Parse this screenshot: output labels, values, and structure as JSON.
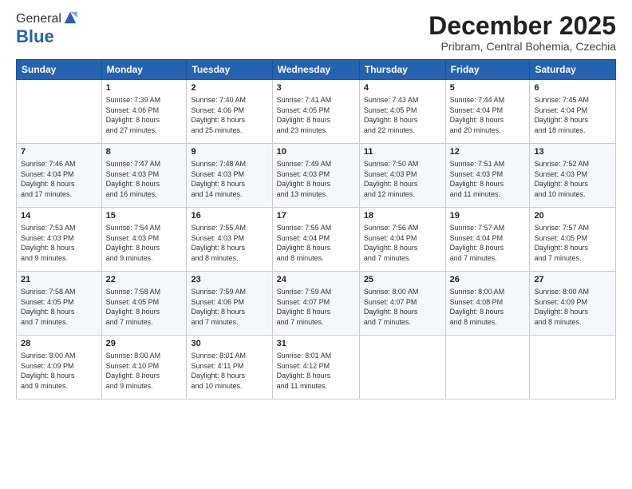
{
  "logo": {
    "general": "General",
    "blue": "Blue"
  },
  "header": {
    "month": "December 2025",
    "location": "Pribram, Central Bohemia, Czechia"
  },
  "weekdays": [
    "Sunday",
    "Monday",
    "Tuesday",
    "Wednesday",
    "Thursday",
    "Friday",
    "Saturday"
  ],
  "weeks": [
    [
      {
        "day": "",
        "info": ""
      },
      {
        "day": "1",
        "info": "Sunrise: 7:39 AM\nSunset: 4:06 PM\nDaylight: 8 hours\nand 27 minutes."
      },
      {
        "day": "2",
        "info": "Sunrise: 7:40 AM\nSunset: 4:06 PM\nDaylight: 8 hours\nand 25 minutes."
      },
      {
        "day": "3",
        "info": "Sunrise: 7:41 AM\nSunset: 4:05 PM\nDaylight: 8 hours\nand 23 minutes."
      },
      {
        "day": "4",
        "info": "Sunrise: 7:43 AM\nSunset: 4:05 PM\nDaylight: 8 hours\nand 22 minutes."
      },
      {
        "day": "5",
        "info": "Sunrise: 7:44 AM\nSunset: 4:04 PM\nDaylight: 8 hours\nand 20 minutes."
      },
      {
        "day": "6",
        "info": "Sunrise: 7:45 AM\nSunset: 4:04 PM\nDaylight: 8 hours\nand 18 minutes."
      }
    ],
    [
      {
        "day": "7",
        "info": "Sunrise: 7:46 AM\nSunset: 4:04 PM\nDaylight: 8 hours\nand 17 minutes."
      },
      {
        "day": "8",
        "info": "Sunrise: 7:47 AM\nSunset: 4:03 PM\nDaylight: 8 hours\nand 16 minutes."
      },
      {
        "day": "9",
        "info": "Sunrise: 7:48 AM\nSunset: 4:03 PM\nDaylight: 8 hours\nand 14 minutes."
      },
      {
        "day": "10",
        "info": "Sunrise: 7:49 AM\nSunset: 4:03 PM\nDaylight: 8 hours\nand 13 minutes."
      },
      {
        "day": "11",
        "info": "Sunrise: 7:50 AM\nSunset: 4:03 PM\nDaylight: 8 hours\nand 12 minutes."
      },
      {
        "day": "12",
        "info": "Sunrise: 7:51 AM\nSunset: 4:03 PM\nDaylight: 8 hours\nand 11 minutes."
      },
      {
        "day": "13",
        "info": "Sunrise: 7:52 AM\nSunset: 4:03 PM\nDaylight: 8 hours\nand 10 minutes."
      }
    ],
    [
      {
        "day": "14",
        "info": "Sunrise: 7:53 AM\nSunset: 4:03 PM\nDaylight: 8 hours\nand 9 minutes."
      },
      {
        "day": "15",
        "info": "Sunrise: 7:54 AM\nSunset: 4:03 PM\nDaylight: 8 hours\nand 9 minutes."
      },
      {
        "day": "16",
        "info": "Sunrise: 7:55 AM\nSunset: 4:03 PM\nDaylight: 8 hours\nand 8 minutes."
      },
      {
        "day": "17",
        "info": "Sunrise: 7:55 AM\nSunset: 4:04 PM\nDaylight: 8 hours\nand 8 minutes."
      },
      {
        "day": "18",
        "info": "Sunrise: 7:56 AM\nSunset: 4:04 PM\nDaylight: 8 hours\nand 7 minutes."
      },
      {
        "day": "19",
        "info": "Sunrise: 7:57 AM\nSunset: 4:04 PM\nDaylight: 8 hours\nand 7 minutes."
      },
      {
        "day": "20",
        "info": "Sunrise: 7:57 AM\nSunset: 4:05 PM\nDaylight: 8 hours\nand 7 minutes."
      }
    ],
    [
      {
        "day": "21",
        "info": "Sunrise: 7:58 AM\nSunset: 4:05 PM\nDaylight: 8 hours\nand 7 minutes."
      },
      {
        "day": "22",
        "info": "Sunrise: 7:58 AM\nSunset: 4:05 PM\nDaylight: 8 hours\nand 7 minutes."
      },
      {
        "day": "23",
        "info": "Sunrise: 7:59 AM\nSunset: 4:06 PM\nDaylight: 8 hours\nand 7 minutes."
      },
      {
        "day": "24",
        "info": "Sunrise: 7:59 AM\nSunset: 4:07 PM\nDaylight: 8 hours\nand 7 minutes."
      },
      {
        "day": "25",
        "info": "Sunrise: 8:00 AM\nSunset: 4:07 PM\nDaylight: 8 hours\nand 7 minutes."
      },
      {
        "day": "26",
        "info": "Sunrise: 8:00 AM\nSunset: 4:08 PM\nDaylight: 8 hours\nand 8 minutes."
      },
      {
        "day": "27",
        "info": "Sunrise: 8:00 AM\nSunset: 4:09 PM\nDaylight: 8 hours\nand 8 minutes."
      }
    ],
    [
      {
        "day": "28",
        "info": "Sunrise: 8:00 AM\nSunset: 4:09 PM\nDaylight: 8 hours\nand 9 minutes."
      },
      {
        "day": "29",
        "info": "Sunrise: 8:00 AM\nSunset: 4:10 PM\nDaylight: 8 hours\nand 9 minutes."
      },
      {
        "day": "30",
        "info": "Sunrise: 8:01 AM\nSunset: 4:11 PM\nDaylight: 8 hours\nand 10 minutes."
      },
      {
        "day": "31",
        "info": "Sunrise: 8:01 AM\nSunset: 4:12 PM\nDaylight: 8 hours\nand 11 minutes."
      },
      {
        "day": "",
        "info": ""
      },
      {
        "day": "",
        "info": ""
      },
      {
        "day": "",
        "info": ""
      }
    ]
  ]
}
